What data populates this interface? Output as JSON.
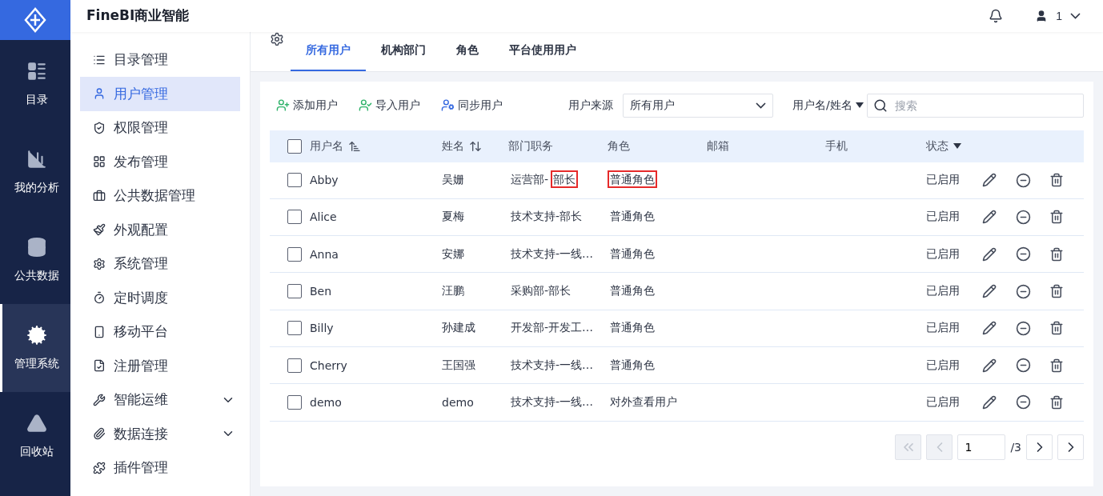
{
  "app": {
    "title": "FineBI商业智能",
    "user": "1"
  },
  "rail": [
    {
      "label": "目录",
      "selected": false
    },
    {
      "label": "我的分析",
      "selected": false
    },
    {
      "label": "公共数据",
      "selected": false
    },
    {
      "label": "管理系统",
      "selected": true
    },
    {
      "label": "回收站",
      "selected": false
    }
  ],
  "menu": [
    {
      "label": "目录管理",
      "selected": false
    },
    {
      "label": "用户管理",
      "selected": true
    },
    {
      "label": "权限管理",
      "selected": false
    },
    {
      "label": "发布管理",
      "selected": false
    },
    {
      "label": "公共数据管理",
      "selected": false
    },
    {
      "label": "外观配置",
      "selected": false
    },
    {
      "label": "系统管理",
      "selected": false
    },
    {
      "label": "定时调度",
      "selected": false
    },
    {
      "label": "移动平台",
      "selected": false
    },
    {
      "label": "注册管理",
      "selected": false
    },
    {
      "label": "智能运维",
      "selected": false,
      "expanded": false
    },
    {
      "label": "数据连接",
      "selected": false,
      "expanded": false
    },
    {
      "label": "插件管理",
      "selected": false
    }
  ],
  "tabs": [
    {
      "label": "所有用户",
      "selected": true
    },
    {
      "label": "机构部门",
      "selected": false
    },
    {
      "label": "角色",
      "selected": false
    },
    {
      "label": "平台使用用户",
      "selected": false
    }
  ],
  "toolbar": {
    "actions": [
      {
        "label": "添加用户",
        "kind": "add"
      },
      {
        "label": "导入用户",
        "kind": "import"
      },
      {
        "label": "同步用户",
        "kind": "sync"
      }
    ],
    "source_label": "用户来源",
    "source_value": "所有用户",
    "search_by": "用户名/姓名",
    "search_placeholder": "搜索"
  },
  "table": {
    "select_all_checked": false,
    "columns": [
      "用户名",
      "姓名",
      "部门职务",
      "角色",
      "邮箱",
      "手机",
      "状态"
    ],
    "rows": [
      {
        "username": "Abby",
        "name": "吴姗",
        "dept": [
          {
            "text": "运营部-",
            "boxed": false
          },
          {
            "text": "部长",
            "boxed": true
          }
        ],
        "role": "普通角色",
        "role_boxed": true,
        "status": "已启用",
        "checked": false
      },
      {
        "username": "Alice",
        "name": "夏梅",
        "dept": [
          {
            "text": "技术支持-部长",
            "boxed": false
          }
        ],
        "role": "普通角色",
        "role_boxed": false,
        "status": "已启用",
        "checked": false
      },
      {
        "username": "Anna",
        "name": "安娜",
        "dept": [
          {
            "text": "技术支持-一线…",
            "boxed": false
          }
        ],
        "role": "普通角色",
        "role_boxed": false,
        "status": "已启用",
        "checked": false
      },
      {
        "username": "Ben",
        "name": "汪鹏",
        "dept": [
          {
            "text": "采购部-部长",
            "boxed": false
          }
        ],
        "role": "普通角色",
        "role_boxed": false,
        "status": "已启用",
        "checked": false
      },
      {
        "username": "Billy",
        "name": "孙建成",
        "dept": [
          {
            "text": "开发部-开发工…",
            "boxed": false
          }
        ],
        "role": "普通角色",
        "role_boxed": false,
        "status": "已启用",
        "checked": false
      },
      {
        "username": "Cherry",
        "name": "王国强",
        "dept": [
          {
            "text": "技术支持-一线…",
            "boxed": false
          }
        ],
        "role": "普通角色",
        "role_boxed": false,
        "status": "已启用",
        "checked": false
      },
      {
        "username": "demo",
        "name": "demo",
        "dept": [
          {
            "text": "技术支持-一线…",
            "boxed": false
          }
        ],
        "role": "对外查看用户",
        "role_boxed": false,
        "status": "已启用",
        "checked": false
      }
    ]
  },
  "pagination": {
    "page": "1",
    "total": "/3"
  }
}
